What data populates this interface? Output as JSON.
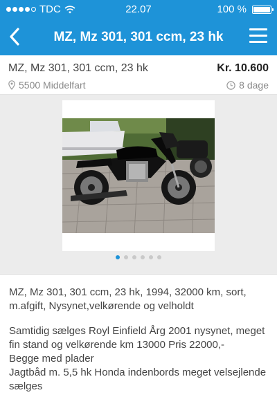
{
  "status_bar": {
    "carrier": "TDC",
    "time": "22.07",
    "battery": "100 %",
    "battery_level": 1.0,
    "signal_bars_filled": 4,
    "signal_bars_total": 5
  },
  "nav": {
    "title": "MZ, Mz 301, 301 ccm, 23 hk",
    "back_icon": "chevron-left-icon",
    "menu_icon": "hamburger-menu-icon",
    "color": "#1e93d8"
  },
  "listing": {
    "title": "MZ, Mz 301, 301 ccm, 23 hk",
    "price": "Kr. 10.600",
    "location": "5500 Middelfart",
    "age": "8 dage",
    "location_icon": "map-pin-icon",
    "age_icon": "clock-icon"
  },
  "gallery": {
    "photo_count": 6,
    "active_index": 0,
    "photo_alt_icon": "motorcycle-photo"
  },
  "description": {
    "paragraph_1": "MZ, Mz 301, 301 ccm, 23 hk, 1994, 32000 km, sort, m.afgift, Nysynet,velkørende og velholdt",
    "paragraph_2": "Samtidig sælges Royl Einfield Årg 2001 nysynet, meget fin stand og velkørende km 13000  Pris 22000,-\nBegge med plader\nJagtbåd m. 5,5 hk Honda indenbords meget velsejlende sælges"
  }
}
